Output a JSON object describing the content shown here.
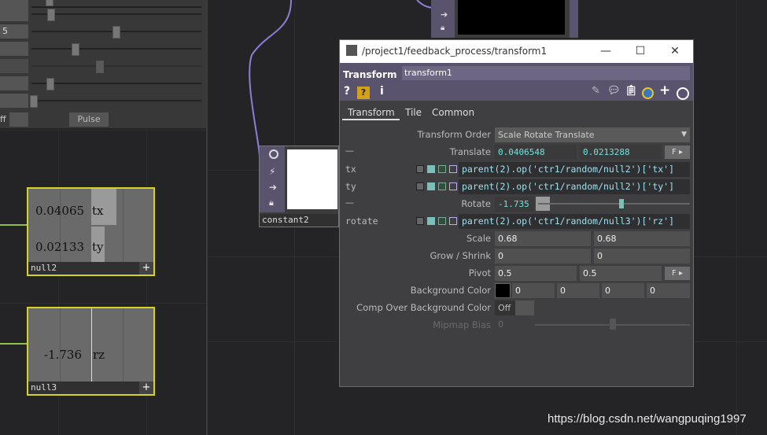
{
  "left_panel": {
    "field_value": "5",
    "off_label": "ff",
    "pulse_label": "Pulse"
  },
  "null2": {
    "tx_value": "0.04065",
    "tx_label": "tx",
    "ty_value": "0.02133",
    "ty_label": "ty",
    "name": "null2",
    "plus": "+"
  },
  "null3": {
    "rz_value": "-1.736",
    "rz_label": "rz",
    "name": "null3",
    "plus": "+"
  },
  "constant2": {
    "name": "constant2"
  },
  "dialog": {
    "title": "/project1/feedback_process/transform1",
    "minimize": "—",
    "maximize": "☐",
    "close": "✕",
    "op_type": "Transform",
    "op_name": "transform1",
    "tabs": [
      "Transform",
      "Tile",
      "Common"
    ],
    "params": {
      "transform_order_label": "Transform Order",
      "transform_order_value": "Scale Rotate Translate",
      "translate_label": "Translate",
      "translate_x": "0.0406548",
      "translate_y": "0.0213288",
      "translate_flag": "F",
      "tx_label": "tx",
      "tx_expr": "parent(2).op('ctr1/random/null2')['tx']",
      "ty_label": "ty",
      "ty_expr": "parent(2).op('ctr1/random/null2')['ty']",
      "rotate_label": "Rotate",
      "rotate_value": "-1.735",
      "rotate_sub_label": "rotate",
      "rotate_expr": "parent(2).op('ctr1/random/null3')['rz']",
      "scale_label": "Scale",
      "scale_x": "0.68",
      "scale_y": "0.68",
      "grow_label": "Grow / Shrink",
      "grow_x": "0",
      "grow_y": "0",
      "pivot_label": "Pivot",
      "pivot_x": "0.5",
      "pivot_y": "0.5",
      "pivot_flag": "F",
      "bg_color_label": "Background Color",
      "bg_r": "0",
      "bg_g": "0",
      "bg_b": "0",
      "bg_a": "0",
      "comp_over_label": "Comp Over Background Color",
      "comp_over_value": "Off",
      "mipmap_label": "Mipmap Bias",
      "mipmap_value": "0",
      "dash": "—"
    }
  },
  "watermark": "https://blog.csdn.net/wangpuqing1997",
  "colors": {
    "accent_purple": "#5a536e",
    "node_highlight": "#d6d321",
    "wire": "#8a7fd4"
  }
}
